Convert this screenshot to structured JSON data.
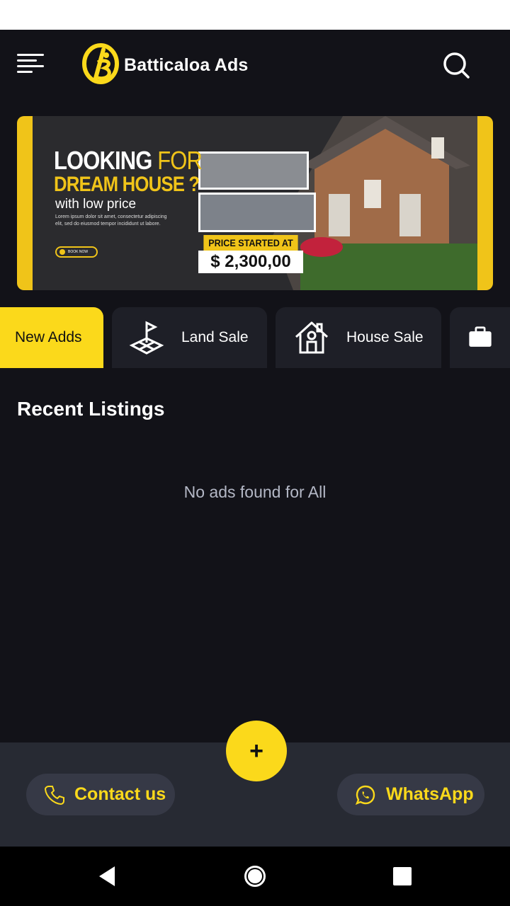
{
  "header": {
    "brand": "Batticaloa Ads",
    "menu_icon": "hamburger-menu-icon",
    "search_icon": "search-icon"
  },
  "banner": {
    "headline_white": "LOOKING",
    "headline_yellow": "FOR",
    "headline_line2": "DREAM HOUSE ?",
    "subline": "with low price",
    "lorem": "Lorem ipsum dolor sit amet, consectetur adipiscing elit, sed do eiusmod tempor incididunt ut labore.",
    "cta": "BOOK NOW",
    "price_label": "PRICE STARTED AT",
    "price_value": "$ 2,300,00"
  },
  "tabs": [
    {
      "label": "New Adds",
      "active": true
    },
    {
      "label": "Land Sale",
      "icon": "land-plot-icon",
      "active": false
    },
    {
      "label": "House Sale",
      "icon": "house-icon",
      "active": false
    },
    {
      "label": "",
      "icon": "briefcase-icon",
      "active": false
    }
  ],
  "listings": {
    "title": "Recent Listings",
    "empty_message": "No ads found for All"
  },
  "bottom": {
    "contact_label": "Contact us",
    "whatsapp_label": "WhatsApp",
    "fab_label": "+"
  },
  "colors": {
    "accent": "#fbd91b",
    "background": "#121218",
    "bottom_bar": "#272a33"
  }
}
